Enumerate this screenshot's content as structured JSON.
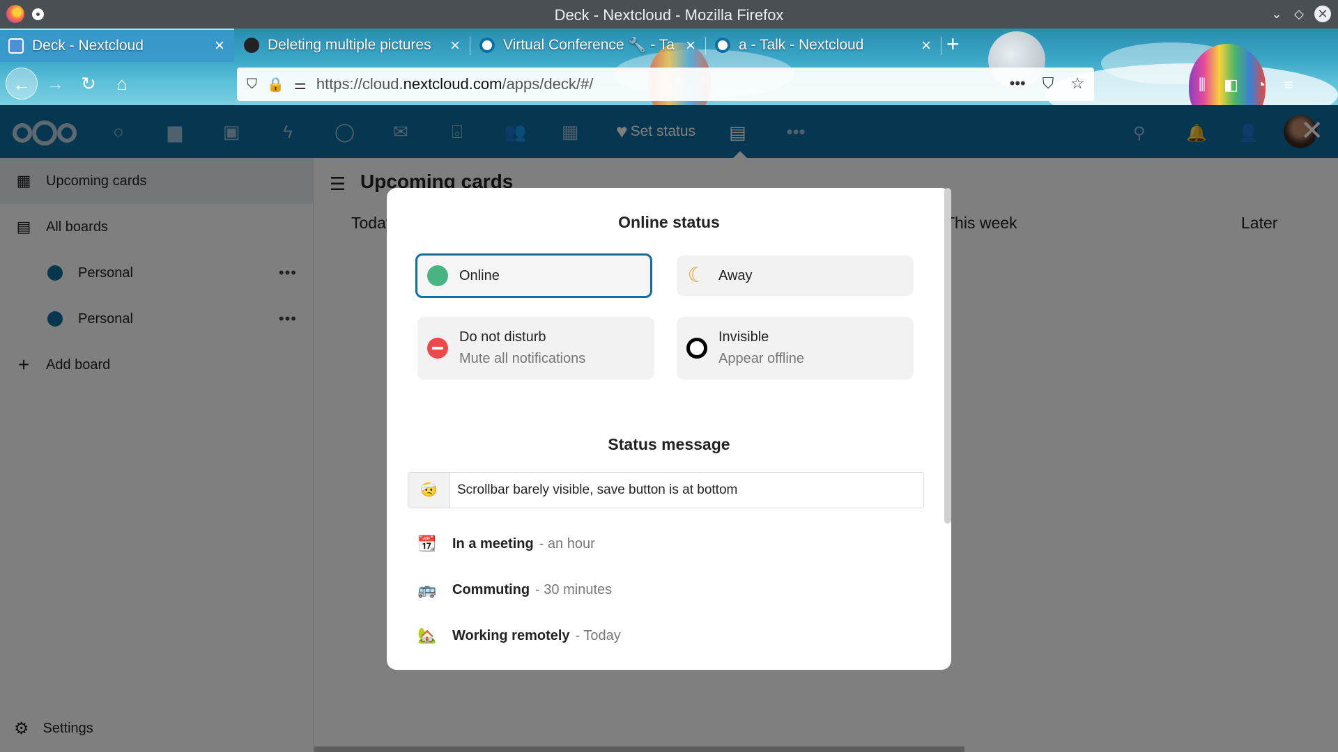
{
  "window": {
    "title": "Deck - Nextcloud - Mozilla Firefox"
  },
  "tabs": [
    {
      "label": "Deck - Nextcloud"
    },
    {
      "label": "Deleting multiple pictures"
    },
    {
      "label": "Virtual Conference 🔧 - Ta"
    },
    {
      "label": "a - Talk - Nextcloud"
    }
  ],
  "urlbar": {
    "prefix": "https://cloud.",
    "domain": "nextcloud.com",
    "path": "/apps/deck/#/"
  },
  "header": {
    "set_status_label": "Set status"
  },
  "sidebar": {
    "items": [
      {
        "label": "Upcoming cards",
        "icon": "calendar-icon"
      },
      {
        "label": "All boards",
        "icon": "deck-icon"
      },
      {
        "label": "Personal",
        "color": "#0e6fa0"
      },
      {
        "label": "Personal",
        "color": "#0e6fa0"
      },
      {
        "label": "Add board",
        "icon": "plus-icon"
      }
    ],
    "more_label": "•••",
    "settings_label": "Settings"
  },
  "main": {
    "title": "Upcoming cards",
    "columns": [
      "Today",
      "This week",
      "Later"
    ]
  },
  "modal": {
    "online_status_title": "Online status",
    "options": [
      {
        "label": "Online",
        "color": "#49b382"
      },
      {
        "label": "Away",
        "color": "#f4a331"
      },
      {
        "label": "Do not disturb",
        "sub": "Mute all notifications",
        "color": "#ed484c"
      },
      {
        "label": "Invisible",
        "sub": "Appear offline",
        "color": "#000000"
      }
    ],
    "status_message_title": "Status message",
    "message": {
      "emoji": "🤕",
      "text": "Scrollbar barely visible, save button is at bottom"
    },
    "presets": [
      {
        "icon": "📆",
        "name": "In a meeting",
        "time": "- an hour"
      },
      {
        "icon": "🚌",
        "name": "Commuting",
        "time": "- 30 minutes"
      },
      {
        "icon": "🏡",
        "name": "Working remotely",
        "time": "- Today"
      }
    ]
  }
}
